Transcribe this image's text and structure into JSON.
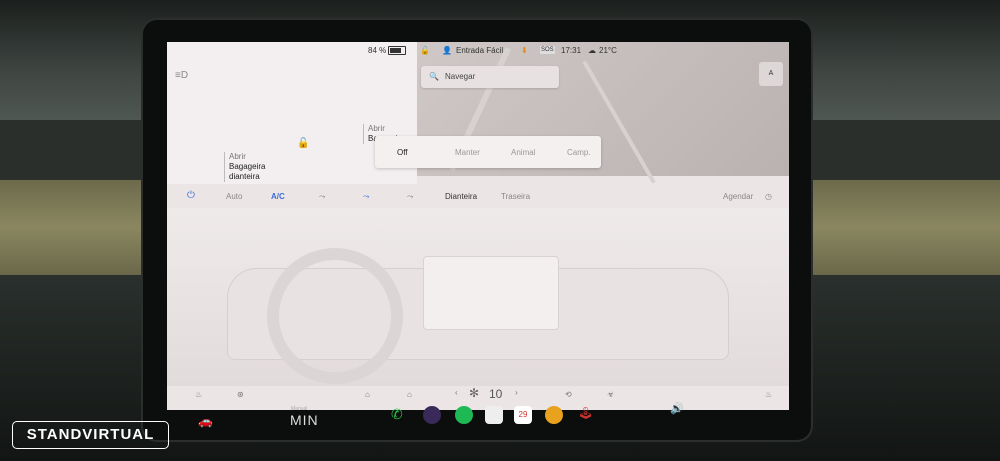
{
  "status": {
    "battery": "84 %",
    "profile": "Entrada Fácil",
    "time": "17:31",
    "temperature": "21°C",
    "sos": "SOS"
  },
  "search": {
    "placeholder": "Navegar"
  },
  "compass": {
    "label": "A"
  },
  "trunks": {
    "rear_action": "Abrir",
    "rear_label": "Bagageira",
    "rear_label2": "dianteira",
    "front_action": "Abrir",
    "front_label": "Bagageira"
  },
  "climate_keep": {
    "off": "Off",
    "keep": "Manter",
    "dog": "Animal",
    "camp": "Camp."
  },
  "climate": {
    "auto": "Auto",
    "ac": "A/C",
    "front": "Dianteira",
    "rear": "Traseira",
    "schedule": "Agendar"
  },
  "fan": {
    "level": "10"
  },
  "taskbar": {
    "gear": "MIN",
    "gear_label": "Manual",
    "calendar_day": "29"
  },
  "watermark": {
    "text": "STANDVIRTUAL"
  },
  "colors": {
    "accent": "#3b6fd6",
    "spotify": "#1db954",
    "phone": "#2fbf4a"
  }
}
